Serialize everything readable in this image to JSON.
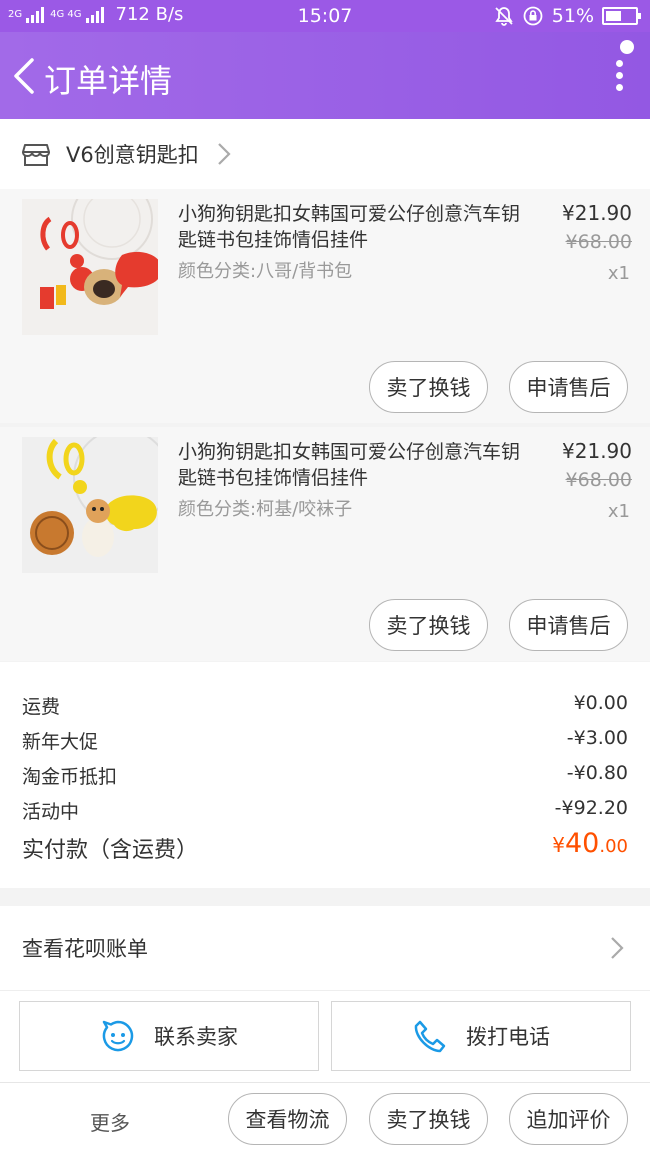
{
  "status_bar": {
    "signal1": "2G",
    "signal2": "4G 4G",
    "net_speed": "712 B/s",
    "time": "15:07",
    "battery_percent": "51%",
    "battery_level": 0.51
  },
  "header": {
    "title": "订单详情"
  },
  "shop": {
    "name": "V6创意钥匙扣"
  },
  "items": [
    {
      "name": "小狗狗钥匙扣女韩国可爱公仔创意汽车钥匙链书包挂饰情侣挂件",
      "spec": "颜色分类:八哥/背书包",
      "price": "¥21.90",
      "original_price": "¥68.00",
      "qty": "x1",
      "btn_sell": "卖了换钱",
      "btn_aftersale": "申请售后"
    },
    {
      "name": "小狗狗钥匙扣女韩国可爱公仔创意汽车钥匙链书包挂饰情侣挂件",
      "spec": "颜色分类:柯基/咬袜子",
      "price": "¥21.90",
      "original_price": "¥68.00",
      "qty": "x1",
      "btn_sell": "卖了换钱",
      "btn_aftersale": "申请售后"
    }
  ],
  "fees": [
    {
      "label": "运费",
      "value": "¥0.00"
    },
    {
      "label": "新年大促",
      "value": "-¥3.00"
    },
    {
      "label": "淘金币抵扣",
      "value": "-¥0.80"
    },
    {
      "label": "活动中",
      "value": "-¥92.20"
    }
  ],
  "total": {
    "label": "实付款（含运费）",
    "currency": "¥",
    "integer": "40",
    "decimal": ".00"
  },
  "huabei": {
    "label": "查看花呗账单"
  },
  "actions": {
    "contact_seller": "联系卖家",
    "call": "拨打电话"
  },
  "bottom_bar": {
    "more": "更多",
    "logistics": "查看物流",
    "sell": "卖了换钱",
    "review": "追加评价"
  },
  "colors": {
    "header": "#9b59e6",
    "price_accent": "#ff5000",
    "icon_blue": "#1b9ae6"
  }
}
